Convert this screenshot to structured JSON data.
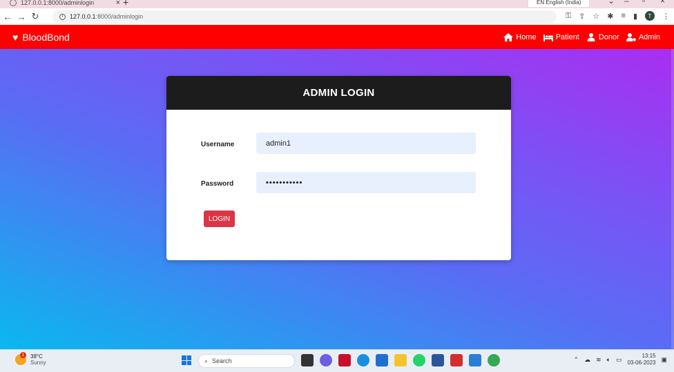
{
  "browser": {
    "tab_title": "127.0.0.1:8000/adminlogin",
    "new_tab": "+",
    "language_indicator": "EN English (India)",
    "url_host": "127.0.0.1",
    "url_path": ":8000/adminlogin",
    "profile_initial": "T"
  },
  "navbar": {
    "brand": "BloodBond",
    "links": [
      {
        "label": "Home",
        "icon": "home-icon"
      },
      {
        "label": "Patient",
        "icon": "bed-icon"
      },
      {
        "label": "Donor",
        "icon": "user-icon"
      },
      {
        "label": "Admin",
        "icon": "user-gear-icon"
      }
    ],
    "color": "#ff0000"
  },
  "login": {
    "title": "ADMIN LOGIN",
    "username_label": "Username",
    "username_value": "admin1",
    "password_label": "Password",
    "password_value": "•••••••••••",
    "button": "LOGIN",
    "button_color": "#dc3545"
  },
  "taskbar": {
    "weather_temp": "38°C",
    "weather_condition": "Sunny",
    "weather_alert": "1",
    "search_label": "Search",
    "time": "13:15",
    "date": "03-06-2023"
  }
}
